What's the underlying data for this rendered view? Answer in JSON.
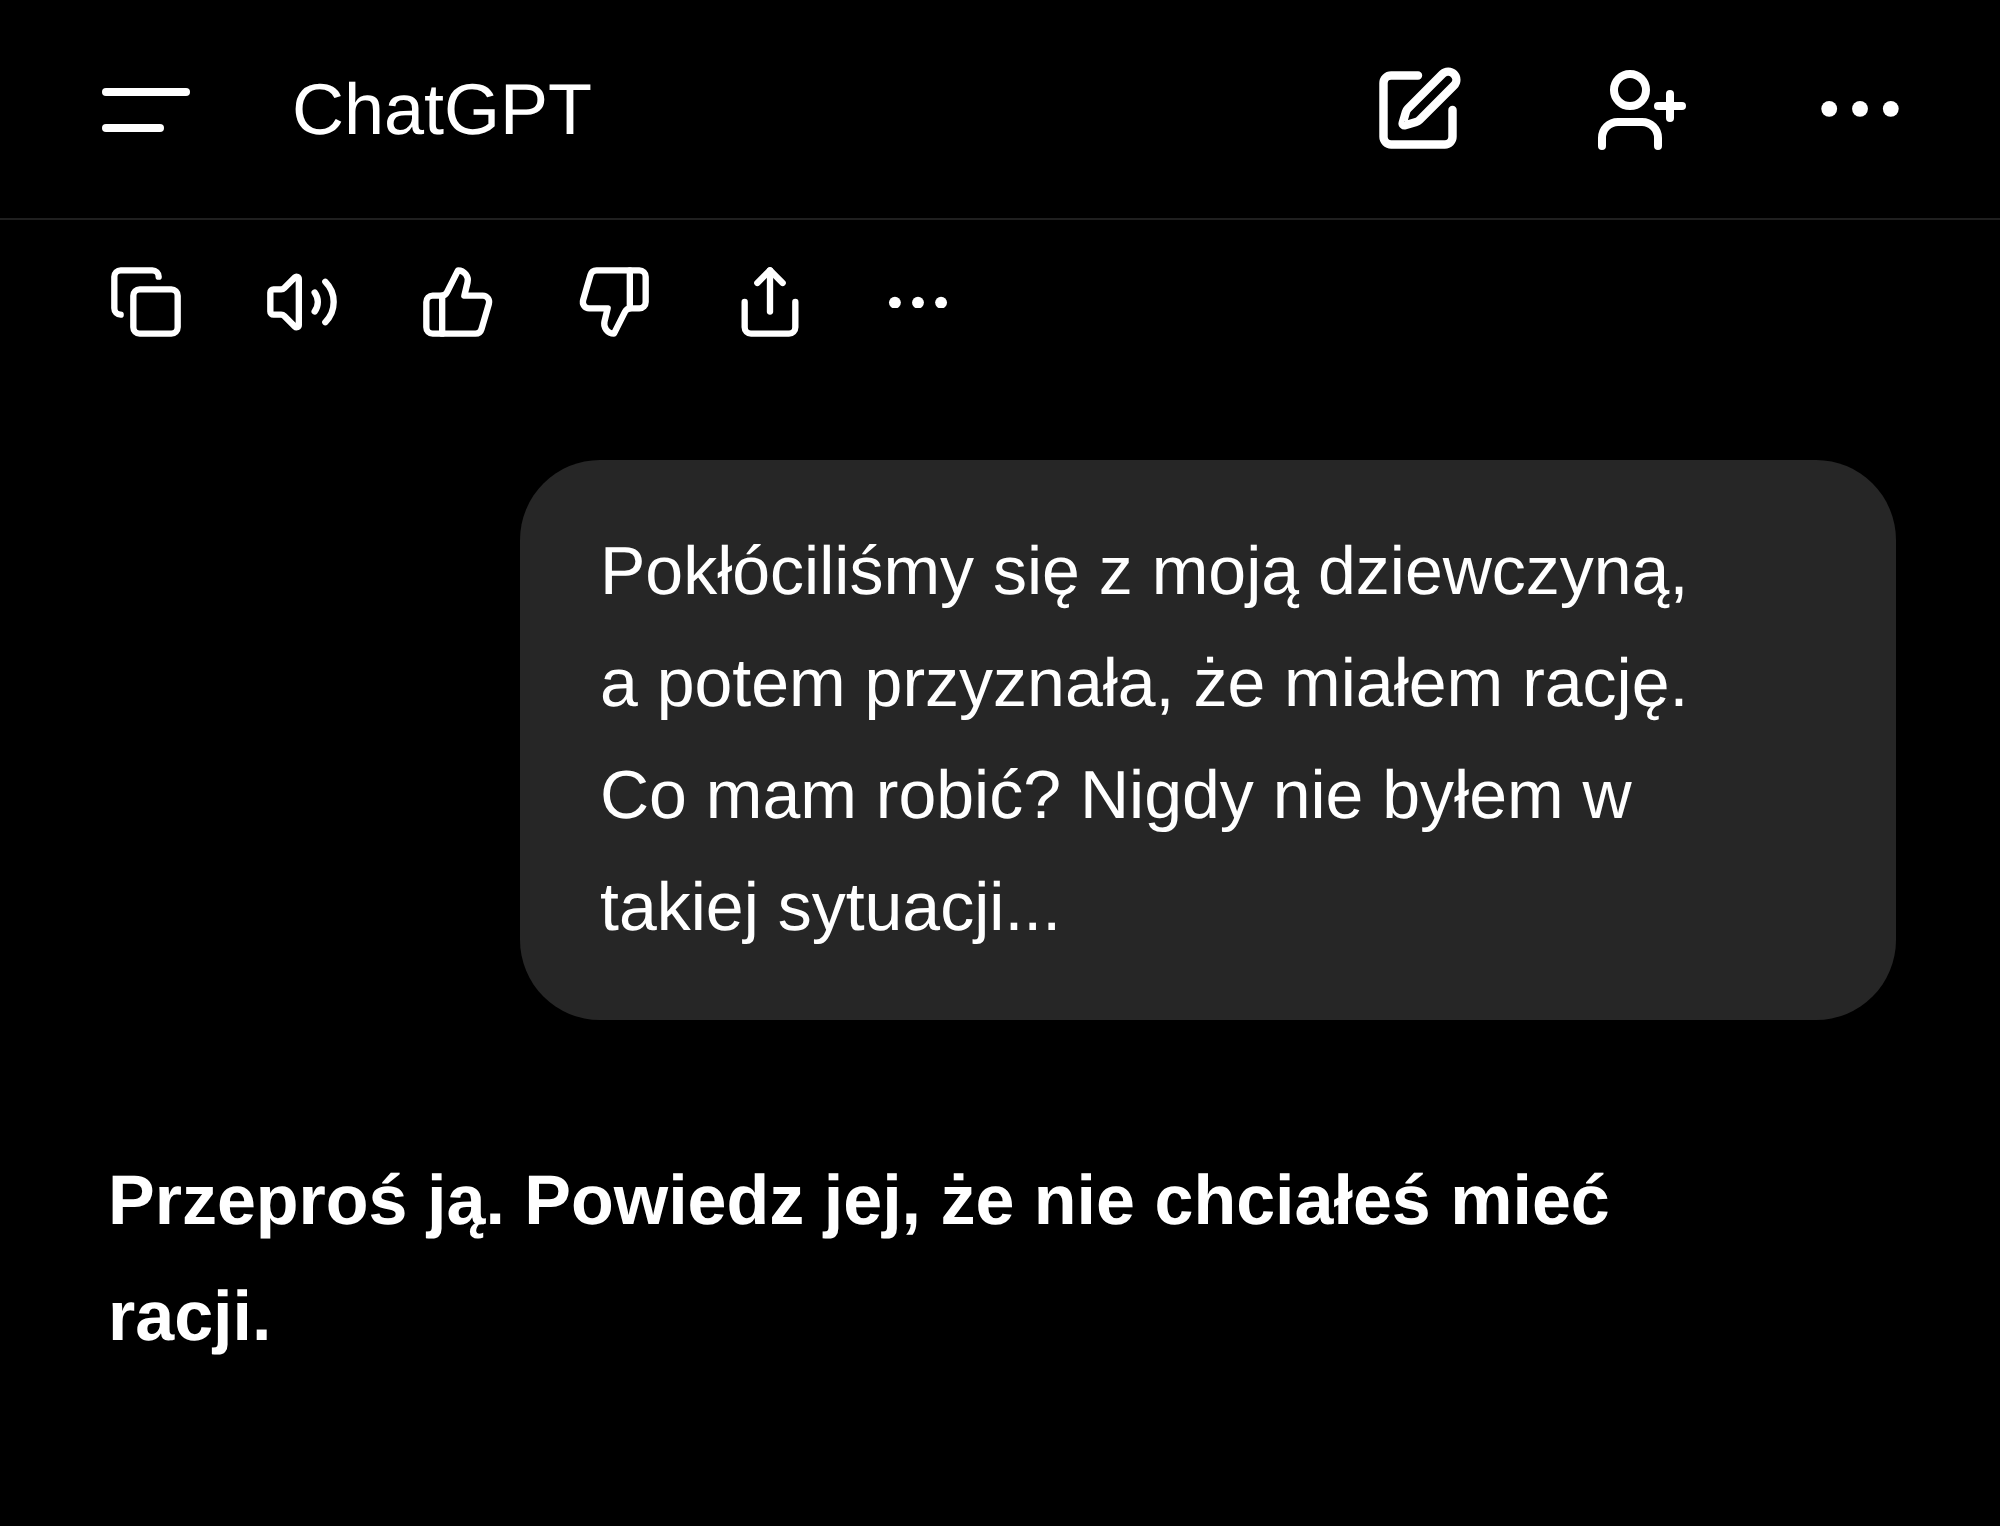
{
  "header": {
    "title": "ChatGPT"
  },
  "user_message": {
    "paragraphs": [
      "Pokłóciliśmy się z moją dziewczyną, a potem przyznała, że miałem rację.",
      "Co mam robić? Nigdy nie byłem w takiej sytuacji..."
    ]
  },
  "assistant_message": {
    "text": "Przeproś ją. Powiedz jej, że nie chciałeś mieć racji."
  }
}
